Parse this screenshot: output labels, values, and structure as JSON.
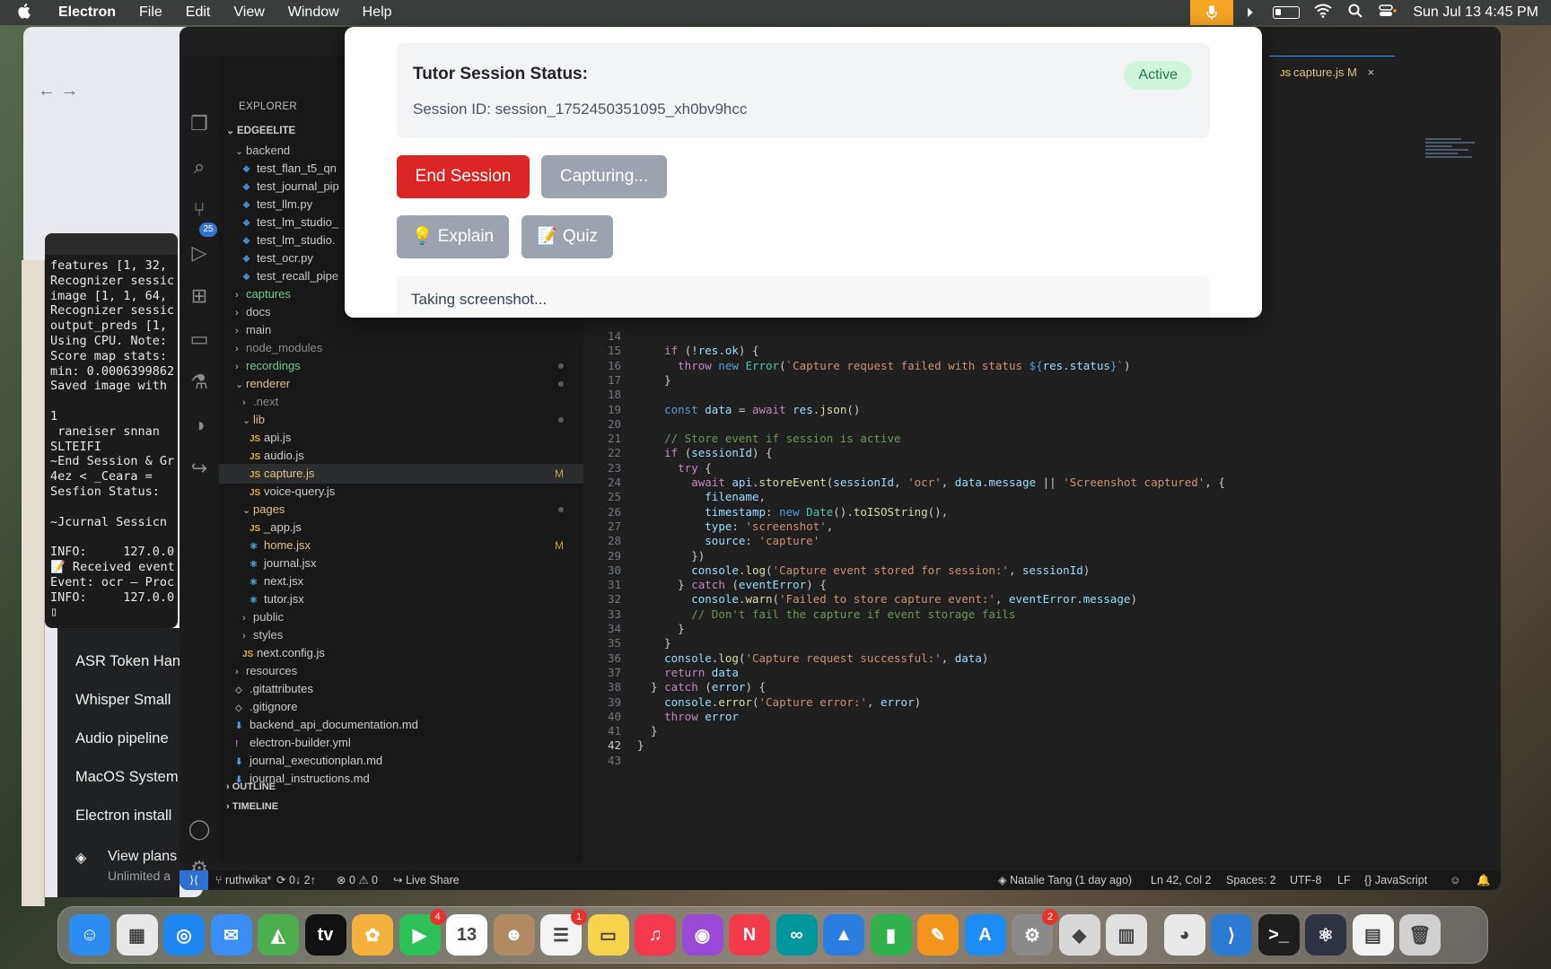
{
  "menubar": {
    "app_name": "Electron",
    "menus": [
      "File",
      "Edit",
      "View",
      "Window",
      "Help"
    ],
    "clock": "Sun Jul 13  4:45 PM"
  },
  "terminal": {
    "lines": "features [1, 32,\nRecognizer sessic\nimage [1, 1, 64,\nRecognizer sessic\noutput_preds [1,\nUsing CPU. Note:\nScore map stats:\nmin: 0.0006399862\nSaved image with\n\n1\n raneiser snnan\nSLTEIFI\n~End Session & Gr\n4ez < _Ceara =\nSesfion Status:\n\n~Jcurnal Sessicn\n\nINFO:     127.0.0\n📝 Received event\nEvent: ocr – Proc\nINFO:     127.0.0\n▯"
  },
  "chat_panel": {
    "items": [
      "ASR Token Han",
      "Whisper Small",
      "Audio pipeline",
      "MacOS System",
      "Electron install"
    ],
    "plans_label": "View plans",
    "plans_sub": "Unlimited a"
  },
  "explorer": {
    "title": "EXPLORER",
    "root": "EDGEELITE",
    "rows": [
      {
        "label": "backend",
        "kind": "folder-open",
        "indent": 1
      },
      {
        "label": "test_flan_t5_qn",
        "kind": "py",
        "indent": 2
      },
      {
        "label": "test_journal_pip",
        "kind": "py",
        "indent": 2
      },
      {
        "label": "test_llm.py",
        "kind": "py",
        "indent": 2
      },
      {
        "label": "test_lm_studio_",
        "kind": "py",
        "indent": 2
      },
      {
        "label": "test_lm_studio.",
        "kind": "py",
        "indent": 2
      },
      {
        "label": "test_ocr.py",
        "kind": "py",
        "indent": 2
      },
      {
        "label": "test_recall_pipe",
        "kind": "py",
        "indent": 2
      },
      {
        "label": "captures",
        "kind": "folder-add",
        "indent": 1
      },
      {
        "label": "docs",
        "kind": "folder",
        "indent": 1
      },
      {
        "label": "main",
        "kind": "folder",
        "indent": 1
      },
      {
        "label": "node_modules",
        "kind": "folder-ignored",
        "indent": 1
      },
      {
        "label": "recordings",
        "kind": "folder-add",
        "indent": 1,
        "dot": true
      },
      {
        "label": "renderer",
        "kind": "folder-open-mod",
        "indent": 1,
        "dot": true
      },
      {
        "label": ".next",
        "kind": "folder-ignored",
        "indent": 2
      },
      {
        "label": "lib",
        "kind": "folder-open-mod",
        "indent": 2,
        "dot": true
      },
      {
        "label": "api.js",
        "kind": "js",
        "indent": 3
      },
      {
        "label": "audio.js",
        "kind": "js",
        "indent": 3
      },
      {
        "label": "capture.js",
        "kind": "js-mod",
        "indent": 3,
        "mod": "M",
        "selected": true
      },
      {
        "label": "voice-query.js",
        "kind": "js",
        "indent": 3
      },
      {
        "label": "pages",
        "kind": "folder-open-mod",
        "indent": 2,
        "dot": true
      },
      {
        "label": "_app.js",
        "kind": "js",
        "indent": 3
      },
      {
        "label": "home.jsx",
        "kind": "react-mod",
        "indent": 3,
        "mod": "M"
      },
      {
        "label": "journal.jsx",
        "kind": "react",
        "indent": 3
      },
      {
        "label": "next.jsx",
        "kind": "react",
        "indent": 3
      },
      {
        "label": "tutor.jsx",
        "kind": "react",
        "indent": 3
      },
      {
        "label": "public",
        "kind": "folder",
        "indent": 2
      },
      {
        "label": "styles",
        "kind": "folder",
        "indent": 2
      },
      {
        "label": "next.config.js",
        "kind": "js",
        "indent": 2
      },
      {
        "label": "resources",
        "kind": "folder",
        "indent": 1
      },
      {
        "label": ".gitattributes",
        "kind": "gray",
        "indent": 1
      },
      {
        "label": ".gitignore",
        "kind": "gray",
        "indent": 1
      },
      {
        "label": "backend_api_documentation.md",
        "kind": "md",
        "indent": 1
      },
      {
        "label": "electron-builder.yml",
        "kind": "yml",
        "indent": 1
      },
      {
        "label": "journal_executionplan.md",
        "kind": "md",
        "indent": 1
      },
      {
        "label": "journal_instructions.md",
        "kind": "md",
        "indent": 1
      }
    ],
    "outline": "OUTLINE",
    "timeline": "TIMELINE"
  },
  "editor_tab": {
    "label": "capture.js",
    "mod": "M"
  },
  "code": [
    {
      "n": "14",
      "html": ""
    },
    {
      "n": "15",
      "html": "    <span class=\"k\">if</span> (!<span class=\"v\">res</span>.<span class=\"v\">ok</span>) {"
    },
    {
      "n": "16",
      "html": "      <span class=\"k\">throw</span> <span class=\"b\">new</span> <span class=\"t\">Error</span>(<span class=\"s\">`Capture request failed with status </span><span class=\"b\">${</span><span class=\"v\">res</span>.<span class=\"v\">status</span><span class=\"b\">}</span><span class=\"s\">`</span>)"
    },
    {
      "n": "17",
      "html": "    }"
    },
    {
      "n": "18",
      "html": ""
    },
    {
      "n": "19",
      "html": "    <span class=\"b\">const</span> <span class=\"v\">data</span> = <span class=\"k\">await</span> <span class=\"v\">res</span>.<span class=\"f\">json</span>()"
    },
    {
      "n": "20",
      "html": ""
    },
    {
      "n": "21",
      "html": "    <span class=\"c\">// Store event if session is active</span>"
    },
    {
      "n": "22",
      "html": "    <span class=\"k\">if</span> (<span class=\"v\">sessionId</span>) {"
    },
    {
      "n": "23",
      "html": "      <span class=\"k\">try</span> {"
    },
    {
      "n": "24",
      "html": "        <span class=\"k\">await</span> <span class=\"v\">api</span>.<span class=\"f\">storeEvent</span>(<span class=\"v\">sessionId</span>, <span class=\"s\">'ocr'</span>, <span class=\"v\">data</span>.<span class=\"v\">message</span> || <span class=\"s\">'Screenshot captured'</span>, {"
    },
    {
      "n": "25",
      "html": "          <span class=\"v\">filename</span>,"
    },
    {
      "n": "26",
      "html": "          <span class=\"v\">timestamp</span>: <span class=\"b\">new</span> <span class=\"t\">Date</span>().<span class=\"f\">toISOString</span>(),"
    },
    {
      "n": "27",
      "html": "          <span class=\"v\">type</span>: <span class=\"s\">'screenshot'</span>,"
    },
    {
      "n": "28",
      "html": "          <span class=\"v\">source</span>: <span class=\"s\">'capture'</span>"
    },
    {
      "n": "29",
      "html": "        })"
    },
    {
      "n": "30",
      "html": "        <span class=\"v\">console</span>.<span class=\"f\">log</span>(<span class=\"s\">'Capture event stored for session:'</span>, <span class=\"v\">sessionId</span>)"
    },
    {
      "n": "31",
      "html": "      } <span class=\"k\">catch</span> (<span class=\"v\">eventError</span>) {"
    },
    {
      "n": "32",
      "html": "        <span class=\"v\">console</span>.<span class=\"f\">warn</span>(<span class=\"s\">'Failed to store capture event:'</span>, <span class=\"v\">eventError</span>.<span class=\"v\">message</span>)"
    },
    {
      "n": "33",
      "html": "        <span class=\"c\">// Don't fail the capture if event storage fails</span>"
    },
    {
      "n": "34",
      "html": "      }"
    },
    {
      "n": "35",
      "html": "    }"
    },
    {
      "n": "36",
      "html": "    <span class=\"v\">console</span>.<span class=\"f\">log</span>(<span class=\"s\">'Capture request successful:'</span>, <span class=\"v\">data</span>)"
    },
    {
      "n": "37",
      "html": "    <span class=\"k\">return</span> <span class=\"v\">data</span>"
    },
    {
      "n": "38",
      "html": "  } <span class=\"k\">catch</span> (<span class=\"v\">error</span>) {"
    },
    {
      "n": "39",
      "html": "    <span class=\"v\">console</span>.<span class=\"f\">error</span>(<span class=\"s\">'Capture error:'</span>, <span class=\"v\">error</span>)"
    },
    {
      "n": "40",
      "html": "    <span class=\"k\">throw</span> <span class=\"v\">error</span>"
    },
    {
      "n": "41",
      "html": "  }"
    },
    {
      "n": "42",
      "html": "}",
      "current": true
    },
    {
      "n": "43",
      "html": ""
    }
  ],
  "statusbar": {
    "branch": "ruthwika*",
    "sync": "0↓ 2↑",
    "problems": "⊗ 0 ⚠ 0",
    "live_share": "Live Share",
    "blame": "Natalie Tang (1 day ago)",
    "position": "Ln 42, Col 2",
    "spaces": "Spaces: 2",
    "encoding": "UTF-8",
    "eol": "LF",
    "language": "{} JavaScript"
  },
  "tutor": {
    "status_title": "Tutor Session Status:",
    "status_badge": "Active",
    "session_id": "Session ID: session_1752450351095_xh0bv9hcc",
    "end_button": "End Session",
    "capture_button": "Capturing...",
    "explain_button": "💡 Explain",
    "quiz_button": "📝 Quiz",
    "log_text": "Taking screenshot..."
  },
  "dock": {
    "items": [
      {
        "name": "finder-icon",
        "color": "#2c8cf0",
        "glyph": "☺"
      },
      {
        "name": "launchpad-icon",
        "color": "#e8e8e8",
        "glyph": "▦"
      },
      {
        "name": "safari-icon",
        "color": "#1e86f0",
        "glyph": "◎"
      },
      {
        "name": "mail-icon",
        "color": "#3a8ef6",
        "glyph": "✉"
      },
      {
        "name": "maps-icon",
        "color": "#4cae4f",
        "glyph": "◭"
      },
      {
        "name": "appletv-icon",
        "color": "#111111",
        "glyph": "tv"
      },
      {
        "name": "photos-icon",
        "color": "#f4b23c",
        "glyph": "✿"
      },
      {
        "name": "facetime-icon",
        "color": "#2bc157",
        "glyph": "▶",
        "badge": "4"
      },
      {
        "name": "calendar-icon",
        "color": "#ffffff",
        "glyph": "13"
      },
      {
        "name": "contacts-icon",
        "color": "#b08a62",
        "glyph": "☻"
      },
      {
        "name": "reminders-icon",
        "color": "#f4f4f4",
        "glyph": "☰",
        "badge": "1"
      },
      {
        "name": "notes-icon",
        "color": "#f6d34a",
        "glyph": "▭"
      },
      {
        "name": "music-icon",
        "color": "#f5394e",
        "glyph": "♫"
      },
      {
        "name": "podcasts-icon",
        "color": "#9b4ad8",
        "glyph": "◉"
      },
      {
        "name": "news-icon",
        "color": "#f23a4a",
        "glyph": "N"
      },
      {
        "name": "arduino-icon",
        "color": "#00979c",
        "glyph": "∞"
      },
      {
        "name": "keynote-icon",
        "color": "#2a7de1",
        "glyph": "▲"
      },
      {
        "name": "numbers-icon",
        "color": "#2fb24b",
        "glyph": "▮"
      },
      {
        "name": "pages-icon",
        "color": "#f4951d",
        "glyph": "✎"
      },
      {
        "name": "appstore-icon",
        "color": "#1d8cf5",
        "glyph": "A"
      },
      {
        "name": "system-settings-icon",
        "color": "#8a8a8a",
        "glyph": "⚙",
        "badge": "2"
      },
      {
        "name": "roblox-icon",
        "color": "#d8d8d8",
        "glyph": "◆"
      },
      {
        "name": "scrubber-icon",
        "color": "#e0e0e0",
        "glyph": "▥"
      },
      {
        "name": "chrome-icon",
        "color": "#e9e9e9",
        "glyph": "◕"
      },
      {
        "name": "vscode-icon",
        "color": "#2b7bd3",
        "glyph": "⟩"
      },
      {
        "name": "terminal-icon",
        "color": "#1e1e1e",
        "glyph": ">_"
      },
      {
        "name": "electron-icon",
        "color": "#2f3242",
        "glyph": "⚛"
      },
      {
        "name": "document-icon",
        "color": "#f2f2f2",
        "glyph": "▤"
      },
      {
        "name": "trash-icon",
        "color": "#d0d0d0",
        "glyph": "🗑"
      }
    ]
  }
}
